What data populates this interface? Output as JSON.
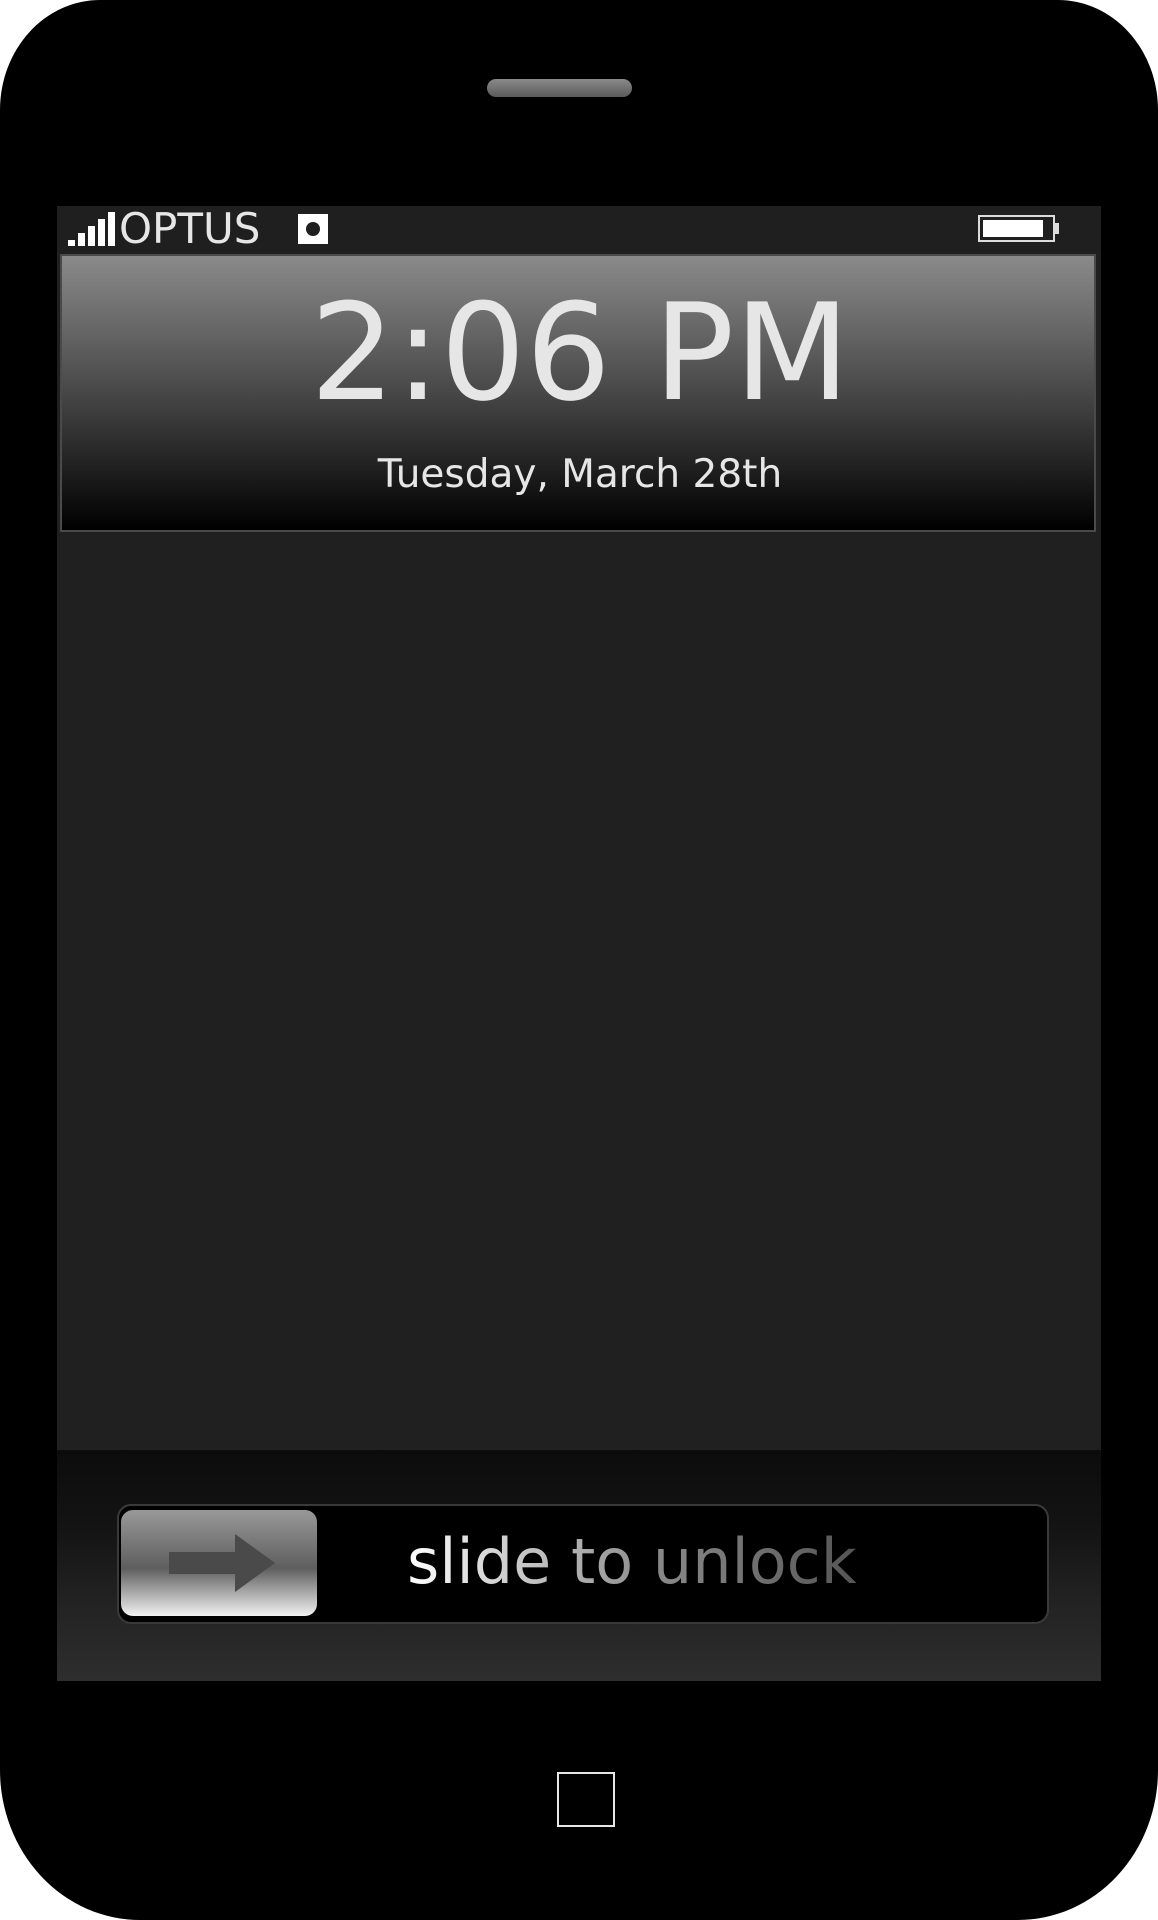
{
  "status_bar": {
    "carrier": "OPTUS",
    "signal_icon": "signal-strength-icon",
    "signal_bars": 5,
    "sync_icon": "sync-indicator-icon",
    "battery_icon": "battery-icon",
    "battery_level": 0.9
  },
  "lock_screen": {
    "time": "2:06 PM",
    "date": "Tuesday, March 28th"
  },
  "unlock": {
    "label": "slide to unlock",
    "arrow_icon": "right-arrow-icon"
  },
  "hardware": {
    "speaker_icon": "earpiece-speaker",
    "home_icon": "home-button-icon"
  },
  "colors": {
    "phone_body": "#000000",
    "screen_background": "#202020",
    "text": "#e6e6e6"
  }
}
